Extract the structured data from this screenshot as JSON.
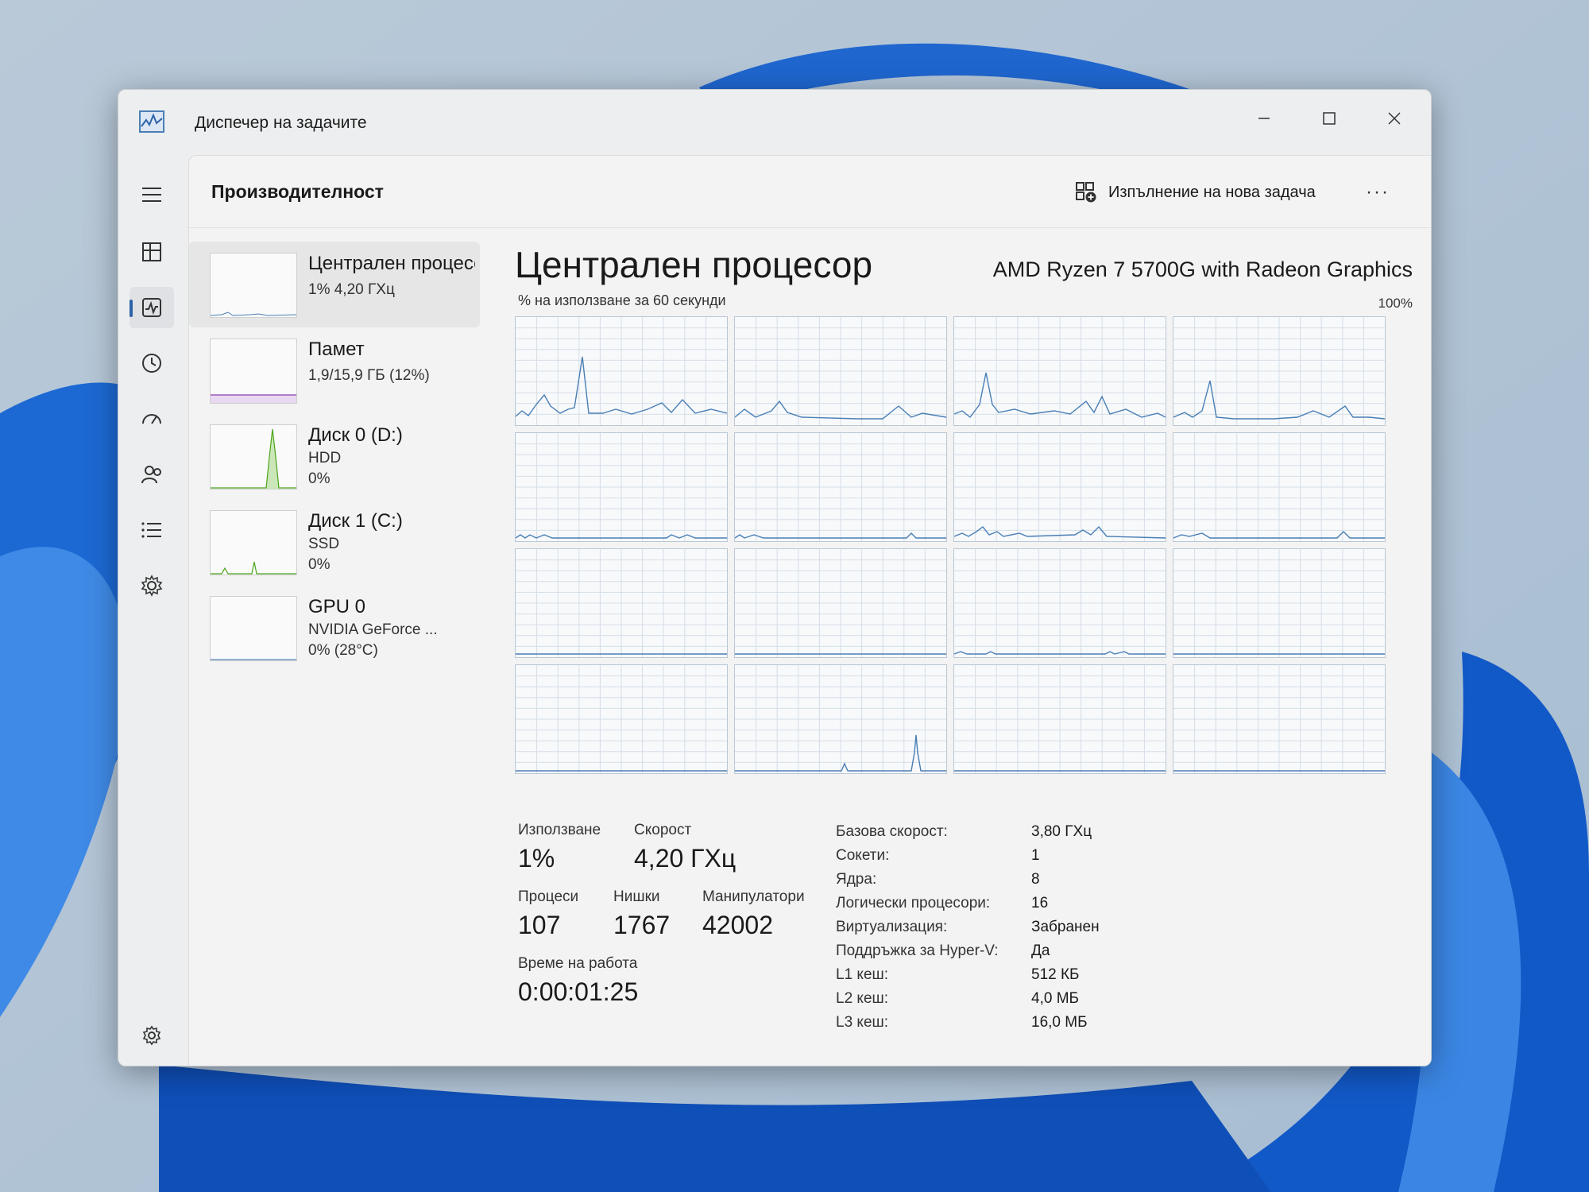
{
  "app": {
    "title": "Диспечер на задачите",
    "accent_color": "#2e62a8",
    "graph_color": "#4a7fb5"
  },
  "window_controls": {
    "minimize_icon": "minimize-icon",
    "maximize_icon": "maximize-icon",
    "close_icon": "close-icon"
  },
  "nav": [
    {
      "icon": "hamburger-menu-icon"
    },
    {
      "icon": "processes-icon"
    },
    {
      "icon": "performance-icon",
      "active": true
    },
    {
      "icon": "app-history-icon"
    },
    {
      "icon": "startup-apps-icon"
    },
    {
      "icon": "users-icon"
    },
    {
      "icon": "details-icon"
    },
    {
      "icon": "services-icon"
    },
    {
      "icon": "settings-icon"
    }
  ],
  "header": {
    "title": "Производителност",
    "run_task_label": "Изпълнение на нова задача",
    "more_label": "···"
  },
  "perf_items": [
    {
      "name": "Централен процесор",
      "line1": "1% 4,20 ГХц",
      "line2": "",
      "graph_color": "#4a7fb5",
      "selected": true
    },
    {
      "name": "Памет",
      "line1": "1,9/15,9 ГБ (12%)",
      "line2": "",
      "graph_color": "#8b3fae"
    },
    {
      "name": "Диск 0 (D:)",
      "line1": "HDD",
      "line2": "0%",
      "graph_color": "#4ca51c"
    },
    {
      "name": "Диск 1 (C:)",
      "line1": "SSD",
      "line2": "0%",
      "graph_color": "#4ca51c"
    },
    {
      "name": "GPU 0",
      "line1": "NVIDIA GeForce ...",
      "line2": "0% (28°C)",
      "graph_color": "#2e62a8"
    }
  ],
  "cpu": {
    "title": "Централен процесор",
    "model": "AMD Ryzen 7 5700G with Radeon Graphics",
    "graph_label": "% на използване за 60 секунди",
    "graph_max": "100%",
    "core_count": 16
  },
  "stats": {
    "usage_label": "Използване",
    "usage_value": "1%",
    "speed_label": "Скорост",
    "speed_value": "4,20 ГХц",
    "processes_label": "Процеси",
    "processes_value": "107",
    "threads_label": "Нишки",
    "threads_value": "1767",
    "handles_label": "Манипулатори",
    "handles_value": "42002",
    "uptime_label": "Време на работа",
    "uptime_value": "0:00:01:25"
  },
  "specs": [
    {
      "label": "Базова скорост:",
      "value": "3,80 ГХц"
    },
    {
      "label": "Сокети:",
      "value": "1"
    },
    {
      "label": "Ядра:",
      "value": "8"
    },
    {
      "label": "Логически процесори:",
      "value": "16"
    },
    {
      "label": "Виртуализация:",
      "value": "Забранен"
    },
    {
      "label": "Поддръжка за Hyper-V:",
      "value": "Да"
    },
    {
      "label": "L1 кеш:",
      "value": "512 КБ"
    },
    {
      "label": "L2 кеш:",
      "value": "4,0 МБ"
    },
    {
      "label": "L3 кеш:",
      "value": "16,0 МБ"
    }
  ]
}
